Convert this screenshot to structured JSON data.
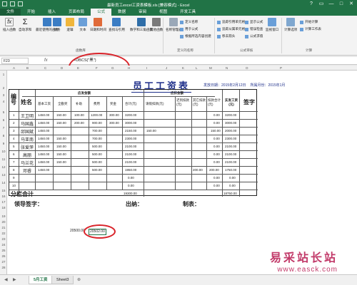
{
  "window": {
    "title": "最新员工excel工资表模板.xls [兼容模式] - Excel",
    "controls": [
      "?",
      "▭",
      "—",
      "□",
      "✕"
    ]
  },
  "tabs": [
    "文件",
    "开始",
    "插入",
    "页面布局",
    "公式",
    "数据",
    "审阅",
    "视图",
    "开发工具"
  ],
  "ribbon": {
    "big_buttons": [
      "插入函数",
      "自动求和",
      "最近使用的函数",
      "财务",
      "逻辑",
      "文本",
      "日期和时间",
      "查找与引用",
      "数学和三角函数",
      "其他函数",
      "名称管理器",
      "计算选项"
    ],
    "small_items": [
      "定义名称",
      "用于公式",
      "根据所选内容创建",
      "追踪引用单元格",
      "追踪从属单元格",
      "移去箭头",
      "显示公式",
      "错误检查",
      "公式求值",
      "监视窗口",
      "开始计算",
      "计算工作表"
    ],
    "groups": [
      "函数库",
      "定义的名称",
      "公式审核",
      "计算"
    ]
  },
  "formula_bar": {
    "name_box": "F23",
    "fx": "fx",
    "formula": "=DBCS(\"黑\")"
  },
  "columns": [
    "A",
    "B",
    "C",
    "D",
    "E",
    "F",
    "G",
    "H",
    "I",
    "J",
    "K",
    "L",
    "M",
    "N",
    "O",
    "P"
  ],
  "rows": [
    "1",
    "2",
    "3",
    "4",
    "5",
    "6",
    "7",
    "8",
    "9",
    "10",
    "11",
    "12",
    "13",
    "14",
    "15",
    "16",
    "17",
    "18",
    "19",
    "20",
    "21",
    "22",
    "23",
    "24",
    "25",
    "26",
    "27",
    "28"
  ],
  "payroll": {
    "title": "员工工资表",
    "date_label": "发放日期：",
    "date_value": "2015年2月12日",
    "period_label": "所属月份：",
    "period_value": "2015年1月",
    "header_no": "编号",
    "header_name": "姓名",
    "header_due": "应发金额",
    "header_deduct": "应扣金额",
    "header_net": "实发工资(元)",
    "header_sign": "签字",
    "due_cols": [
      "基本工资",
      "全勤奖",
      "补助",
      "费用",
      "奖金",
      "合计(元)"
    ],
    "deduct_cols": [
      "请假扣款(元)",
      "迟到扣款(元)",
      "其它扣款(元)",
      "扣款合计(元)"
    ],
    "rows": [
      {
        "no": "1",
        "name": "王卫明",
        "base": "1450.00",
        "full": "150.00",
        "sub": "100.00",
        "fee": "1200.00",
        "bonus": "300.00",
        "total": "3200.00",
        "leave": "",
        "late": "",
        "other": "",
        "dsum": "0.00",
        "net": "3200.00"
      },
      {
        "no": "2",
        "name": "马国鑫",
        "base": "1450.00",
        "full": "150.00",
        "sub": "200.00",
        "fee": "900.00",
        "bonus": "300.00",
        "total": "3000.00",
        "leave": "",
        "late": "",
        "other": "",
        "dsum": "0.00",
        "net": "3000.00"
      },
      {
        "no": "3",
        "name": "邱国斌",
        "base": "1450.00",
        "full": "",
        "sub": "",
        "fee": "700.00",
        "bonus": "",
        "total": "2150.00",
        "leave": "150.00",
        "late": "",
        "other": "",
        "dsum": "150.00",
        "net": "2000.00"
      },
      {
        "no": "4",
        "name": "马亚南",
        "base": "1450.00",
        "full": "150.00",
        "sub": "",
        "fee": "700.00",
        "bonus": "",
        "total": "2300.00",
        "leave": "",
        "late": "",
        "other": "",
        "dsum": "0.00",
        "net": "2300.00"
      },
      {
        "no": "5",
        "name": "张爱萍",
        "base": "1450.00",
        "full": "150.00",
        "sub": "",
        "fee": "500.00",
        "bonus": "",
        "total": "2100.00",
        "leave": "",
        "late": "",
        "other": "",
        "dsum": "0.00",
        "net": "2100.00"
      },
      {
        "no": "6",
        "name": "高丽",
        "base": "1450.00",
        "full": "150.00",
        "sub": "",
        "fee": "500.00",
        "bonus": "",
        "total": "2100.00",
        "leave": "",
        "late": "",
        "other": "",
        "dsum": "0.00",
        "net": "2100.00"
      },
      {
        "no": "7",
        "name": "马兰花",
        "base": "1450.00",
        "full": "150.00",
        "sub": "",
        "fee": "500.00",
        "bonus": "",
        "total": "2100.00",
        "leave": "",
        "late": "",
        "other": "",
        "dsum": "0.00",
        "net": "2100.00"
      },
      {
        "no": "8",
        "name": "邓睿",
        "base": "1450.00",
        "full": "",
        "sub": "",
        "fee": "500.00",
        "bonus": "",
        "total": "1950.00",
        "leave": "",
        "late": "200.00",
        "other": "",
        "dsum": "200.00",
        "net": "1750.00"
      },
      {
        "no": "9",
        "name": "",
        "base": "",
        "full": "",
        "sub": "",
        "fee": "",
        "bonus": "",
        "total": "0.00",
        "leave": "",
        "late": "",
        "other": "",
        "dsum": "0.00",
        "net": "0.00"
      },
      {
        "no": "10",
        "name": "",
        "base": "",
        "full": "",
        "sub": "",
        "fee": "",
        "bonus": "",
        "total": "0.00",
        "leave": "",
        "late": "",
        "other": "",
        "dsum": "0.00",
        "net": "0.00"
      }
    ],
    "subtotal_label": "分栏合计",
    "subtotal_total": "19300.00",
    "subtotal_net": "18750.00",
    "sign_leader": "领导签字：",
    "sign_cashier": "出纳：",
    "sign_preparer": "制表："
  },
  "sum_cells": {
    "e23": "20500.00",
    "f23": "20502.00"
  },
  "sheet_tabs": [
    "5月工资",
    "Sheet3"
  ],
  "sheet_nav": [
    "◀",
    "▶",
    "⊕"
  ],
  "watermark": {
    "line1": "易采站长站",
    "line2": "www.easck.com"
  },
  "colors": {
    "excel_green": "#217346",
    "title_blue": "#1e2f8a",
    "highlight_red": "#d9232a",
    "watermark": "#c23b6a"
  }
}
